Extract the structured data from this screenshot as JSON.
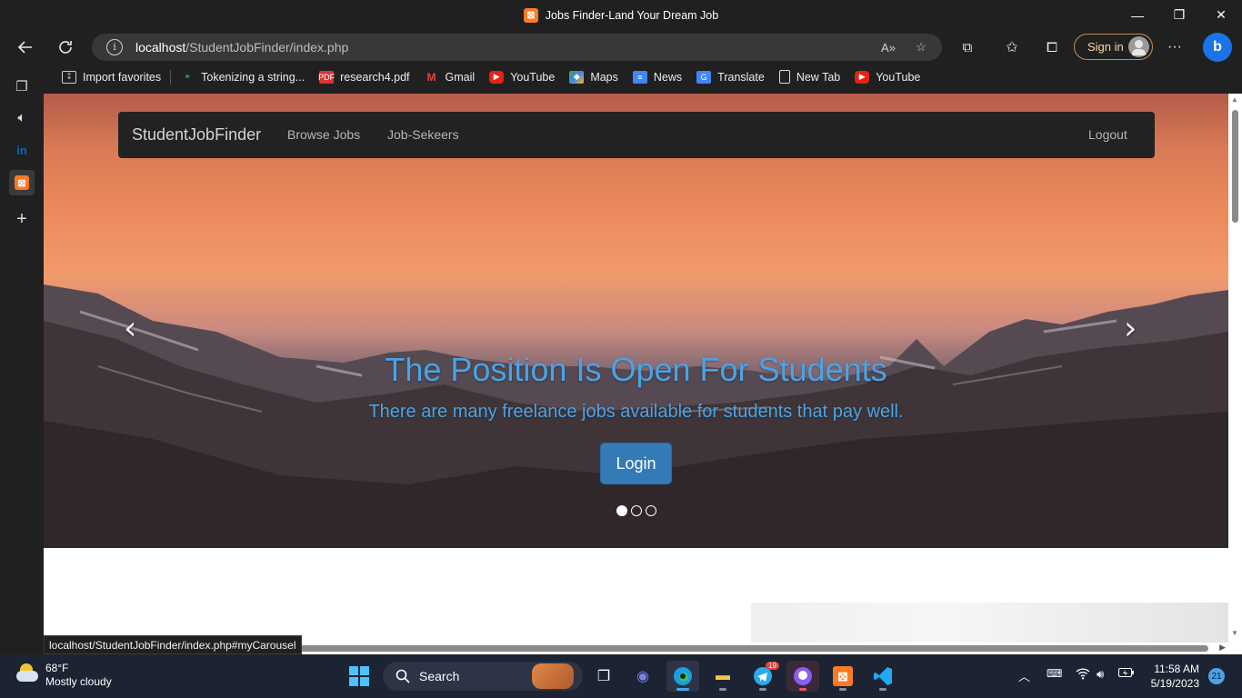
{
  "window": {
    "title": "Jobs Finder-Land Your Dream Job",
    "minimize_glyph": "—",
    "restore_glyph": "❐",
    "close_glyph": "✕"
  },
  "browser": {
    "url_host": "localhost",
    "url_path": "/StudentJobFinder/index.php",
    "sign_in_label": "Sign in",
    "status_url": "localhost/StudentJobFinder/index.php#myCarousel",
    "favorites": [
      {
        "label": "Import favorites",
        "icon": "import-icon"
      },
      {
        "label": "Tokenizing a string...",
        "icon": "site-icon"
      },
      {
        "label": "research4.pdf",
        "icon": "pdf-icon"
      },
      {
        "label": "Gmail",
        "icon": "gmail-icon"
      },
      {
        "label": "YouTube",
        "icon": "youtube-icon"
      },
      {
        "label": "Maps",
        "icon": "maps-icon"
      },
      {
        "label": "News",
        "icon": "news-icon"
      },
      {
        "label": "Translate",
        "icon": "translate-icon"
      },
      {
        "label": "New Tab",
        "icon": "page-icon"
      },
      {
        "label": "YouTube",
        "icon": "youtube-icon"
      }
    ]
  },
  "site": {
    "brand": "StudentJobFinder",
    "nav": {
      "browse_jobs": "Browse Jobs",
      "job_seekers": "Job-Sekeers",
      "logout": "Logout"
    },
    "carousel": {
      "title": "The Position Is Open For Students",
      "subtitle": "There are many freelance jobs available for students that pay well.",
      "button": "Login",
      "active_slide": 1,
      "slide_count": 3
    }
  },
  "taskbar": {
    "weather_temp": "68°F",
    "weather_desc": "Mostly cloudy",
    "search_label": "Search",
    "telegram_badge": "19",
    "time": "11:58 AM",
    "date": "5/19/2023",
    "notifications": "21"
  },
  "colors": {
    "caption": "#4aa3e6",
    "button": "#337ab7",
    "navbar": "#222222"
  }
}
